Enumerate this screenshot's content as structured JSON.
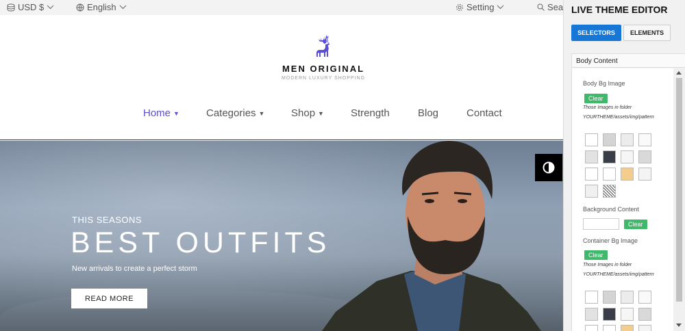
{
  "topbar": {
    "currency": "USD $",
    "language": "English",
    "setting": "Setting",
    "search": "Sear"
  },
  "header": {
    "brand": "MEN ORIGINAL",
    "tagline": "MODERN LUXURY SHOPPING",
    "logo_icon": "deer-icon",
    "nav": {
      "home": "Home",
      "categories": "Categories",
      "shop": "Shop",
      "strength": "Strength",
      "blog": "Blog",
      "contact": "Contact"
    }
  },
  "hero": {
    "subtitle": "THIS SEASONS",
    "title": "BEST OUTFITS",
    "description": "New arrivals to create a perfect storm",
    "button": "READ MORE",
    "toggle_icon": "contrast-icon"
  },
  "editor": {
    "title": "LIVE THEME EDITOR",
    "tab_selectors": "SELECTORS",
    "tab_elements": "ELEMENTS",
    "section_title": "Body Content",
    "body_bg_label": "Body Bg Image",
    "clear": "Clear",
    "folder_note_1": "Those Images in folder",
    "folder_note_2": "YOURTHEME/assets/img/pattern",
    "bg_content_label": "Background Content",
    "container_bg_label": "Container Bg Image",
    "accent_color": "#1677d6",
    "clear_color": "#3fb86a"
  }
}
